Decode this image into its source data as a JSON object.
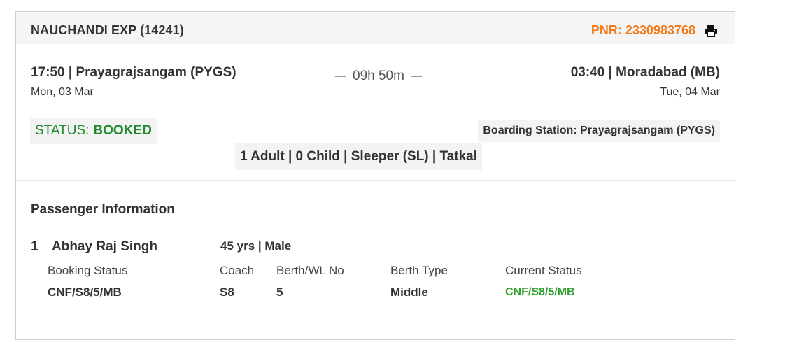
{
  "header": {
    "train_name": "NAUCHANDI EXP (14241)",
    "pnr_label": "PNR: 2330983768",
    "print_icon": "printer-icon"
  },
  "journey": {
    "departure": {
      "time_station": "17:50 | Prayagrajsangam (PYGS)",
      "date": "Mon, 03 Mar"
    },
    "duration": "09h 50m",
    "arrival": {
      "time_station": "03:40 | Moradabad (MB)",
      "date": "Tue, 04 Mar"
    }
  },
  "status": {
    "label": "STATUS:",
    "value": "BOOKED"
  },
  "boarding": "Boarding Station: Prayagrajsangam (PYGS)",
  "passenger_summary": "1 Adult | 0 Child | Sleeper (SL) | Tatkal",
  "passenger_info": {
    "title": "Passenger Information",
    "passengers": [
      {
        "index": "1",
        "name": "Abhay Raj Singh",
        "meta": "45 yrs | Male",
        "columns": {
          "booking_status": {
            "header": "Booking Status",
            "value": "CNF/S8/5/MB"
          },
          "coach": {
            "header": "Coach",
            "value": "S8"
          },
          "berth": {
            "header": "Berth/WL No",
            "value": "5"
          },
          "berth_type": {
            "header": "Berth Type",
            "value": "Middle"
          },
          "current_status": {
            "header": "Current Status",
            "value": "CNF/S8/5/MB"
          }
        }
      }
    ]
  },
  "colors": {
    "accent": "#f27a1a",
    "status_green": "#1f8a2a",
    "current_status_green": "#2ea12e"
  }
}
